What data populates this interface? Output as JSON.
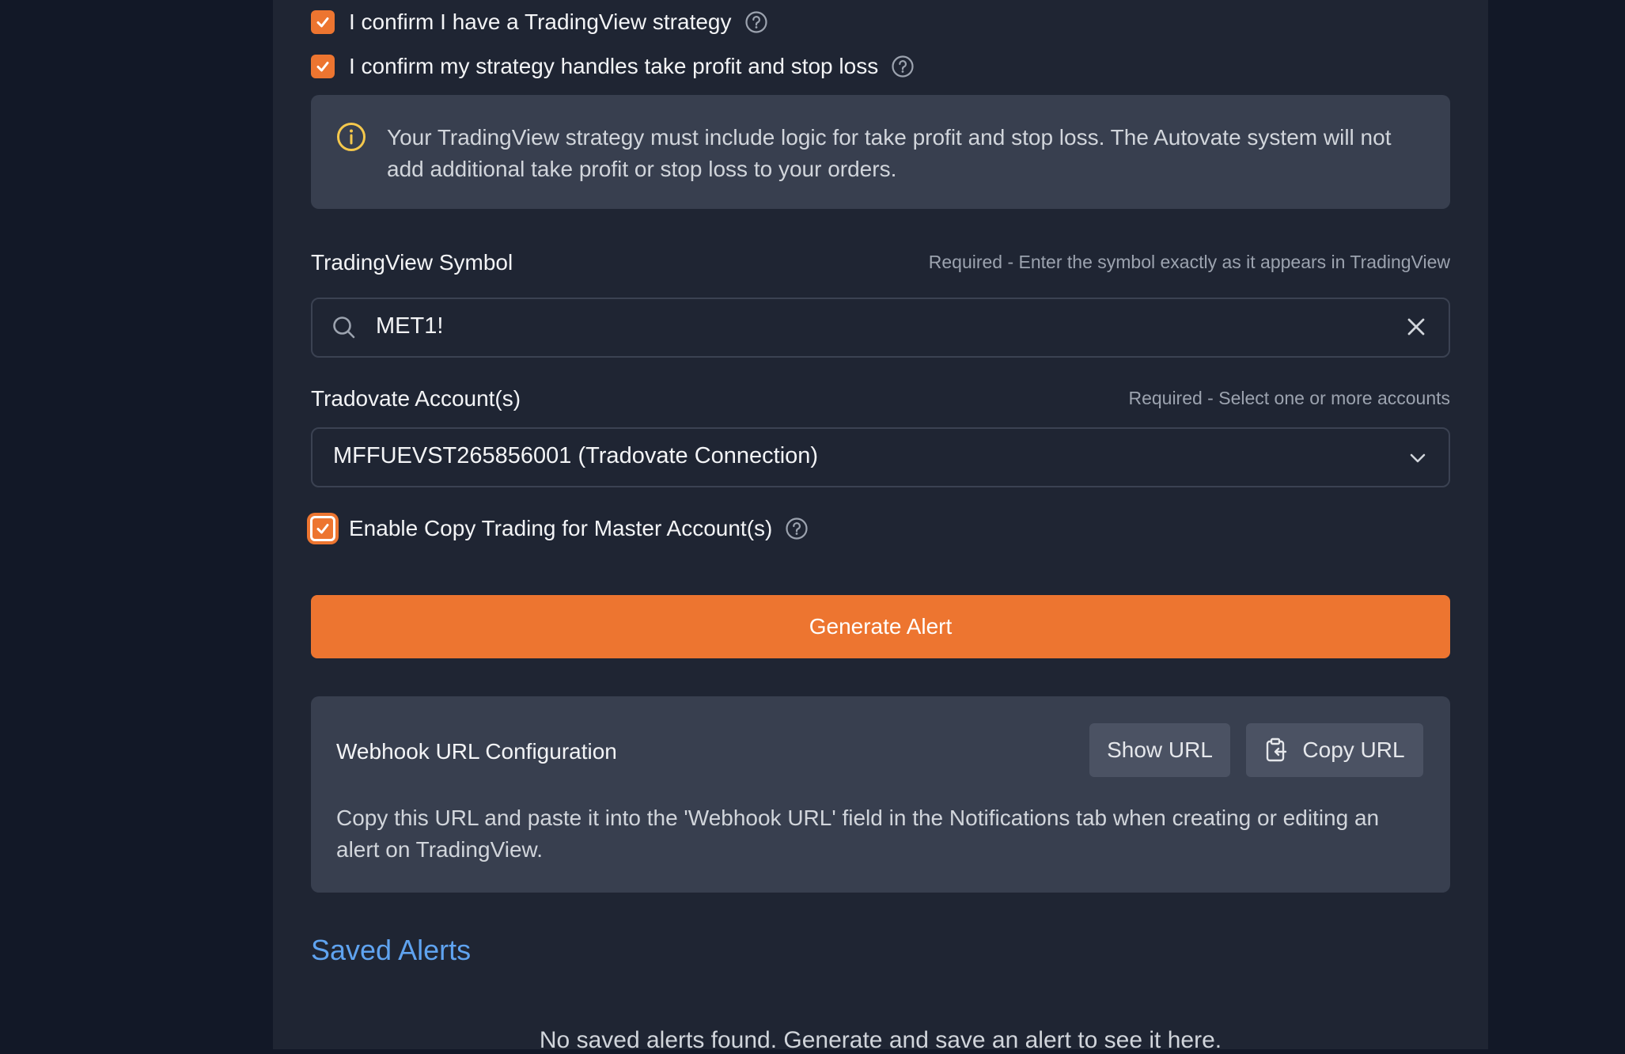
{
  "checks": {
    "strategy_label": "I confirm I have a TradingView strategy",
    "tpsl_label": "I confirm my strategy handles take profit and stop loss",
    "copy_trading_label": "Enable Copy Trading for Master Account(s)"
  },
  "info": {
    "text": "Your TradingView strategy must include logic for take profit and stop loss. The Autovate system will not add additional take profit or stop loss to your orders."
  },
  "symbol": {
    "label": "TradingView Symbol",
    "hint": "Required - Enter the symbol exactly as it appears in TradingView",
    "value": "MET1!"
  },
  "accounts": {
    "label": "Tradovate Account(s)",
    "hint": "Required - Select one or more accounts",
    "selected": "MFFUEVST265856001 (Tradovate Connection)"
  },
  "generate_button": "Generate Alert",
  "webhook": {
    "title": "Webhook URL Configuration",
    "show_url": "Show URL",
    "copy_url": "Copy URL",
    "description": "Copy this URL and paste it into the 'Webhook URL' field in the Notifications tab when creating or editing an alert on TradingView."
  },
  "saved_alerts": {
    "title": "Saved Alerts",
    "empty_text": "No saved alerts found. Generate and save an alert to see it here."
  },
  "colors": {
    "accent": "#ed7530",
    "link": "#5fa3f0",
    "warning": "#f5c84c"
  }
}
